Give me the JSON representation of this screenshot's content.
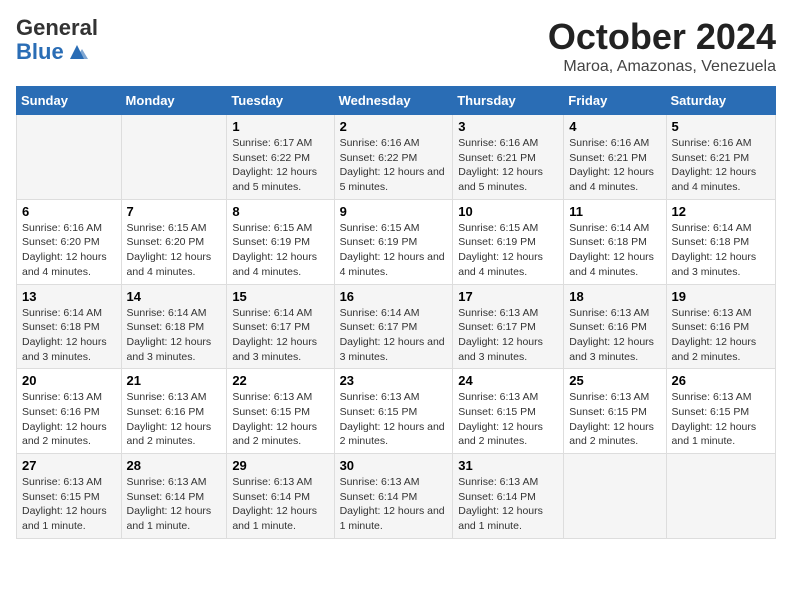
{
  "logo": {
    "general": "General",
    "blue": "Blue"
  },
  "title": "October 2024",
  "subtitle": "Maroa, Amazonas, Venezuela",
  "days_of_week": [
    "Sunday",
    "Monday",
    "Tuesday",
    "Wednesday",
    "Thursday",
    "Friday",
    "Saturday"
  ],
  "weeks": [
    [
      {
        "day": "",
        "detail": ""
      },
      {
        "day": "",
        "detail": ""
      },
      {
        "day": "1",
        "detail": "Sunrise: 6:17 AM\nSunset: 6:22 PM\nDaylight: 12 hours and 5 minutes."
      },
      {
        "day": "2",
        "detail": "Sunrise: 6:16 AM\nSunset: 6:22 PM\nDaylight: 12 hours and 5 minutes."
      },
      {
        "day": "3",
        "detail": "Sunrise: 6:16 AM\nSunset: 6:21 PM\nDaylight: 12 hours and 5 minutes."
      },
      {
        "day": "4",
        "detail": "Sunrise: 6:16 AM\nSunset: 6:21 PM\nDaylight: 12 hours and 4 minutes."
      },
      {
        "day": "5",
        "detail": "Sunrise: 6:16 AM\nSunset: 6:21 PM\nDaylight: 12 hours and 4 minutes."
      }
    ],
    [
      {
        "day": "6",
        "detail": "Sunrise: 6:16 AM\nSunset: 6:20 PM\nDaylight: 12 hours and 4 minutes."
      },
      {
        "day": "7",
        "detail": "Sunrise: 6:15 AM\nSunset: 6:20 PM\nDaylight: 12 hours and 4 minutes."
      },
      {
        "day": "8",
        "detail": "Sunrise: 6:15 AM\nSunset: 6:19 PM\nDaylight: 12 hours and 4 minutes."
      },
      {
        "day": "9",
        "detail": "Sunrise: 6:15 AM\nSunset: 6:19 PM\nDaylight: 12 hours and 4 minutes."
      },
      {
        "day": "10",
        "detail": "Sunrise: 6:15 AM\nSunset: 6:19 PM\nDaylight: 12 hours and 4 minutes."
      },
      {
        "day": "11",
        "detail": "Sunrise: 6:14 AM\nSunset: 6:18 PM\nDaylight: 12 hours and 4 minutes."
      },
      {
        "day": "12",
        "detail": "Sunrise: 6:14 AM\nSunset: 6:18 PM\nDaylight: 12 hours and 3 minutes."
      }
    ],
    [
      {
        "day": "13",
        "detail": "Sunrise: 6:14 AM\nSunset: 6:18 PM\nDaylight: 12 hours and 3 minutes."
      },
      {
        "day": "14",
        "detail": "Sunrise: 6:14 AM\nSunset: 6:18 PM\nDaylight: 12 hours and 3 minutes."
      },
      {
        "day": "15",
        "detail": "Sunrise: 6:14 AM\nSunset: 6:17 PM\nDaylight: 12 hours and 3 minutes."
      },
      {
        "day": "16",
        "detail": "Sunrise: 6:14 AM\nSunset: 6:17 PM\nDaylight: 12 hours and 3 minutes."
      },
      {
        "day": "17",
        "detail": "Sunrise: 6:13 AM\nSunset: 6:17 PM\nDaylight: 12 hours and 3 minutes."
      },
      {
        "day": "18",
        "detail": "Sunrise: 6:13 AM\nSunset: 6:16 PM\nDaylight: 12 hours and 3 minutes."
      },
      {
        "day": "19",
        "detail": "Sunrise: 6:13 AM\nSunset: 6:16 PM\nDaylight: 12 hours and 2 minutes."
      }
    ],
    [
      {
        "day": "20",
        "detail": "Sunrise: 6:13 AM\nSunset: 6:16 PM\nDaylight: 12 hours and 2 minutes."
      },
      {
        "day": "21",
        "detail": "Sunrise: 6:13 AM\nSunset: 6:16 PM\nDaylight: 12 hours and 2 minutes."
      },
      {
        "day": "22",
        "detail": "Sunrise: 6:13 AM\nSunset: 6:15 PM\nDaylight: 12 hours and 2 minutes."
      },
      {
        "day": "23",
        "detail": "Sunrise: 6:13 AM\nSunset: 6:15 PM\nDaylight: 12 hours and 2 minutes."
      },
      {
        "day": "24",
        "detail": "Sunrise: 6:13 AM\nSunset: 6:15 PM\nDaylight: 12 hours and 2 minutes."
      },
      {
        "day": "25",
        "detail": "Sunrise: 6:13 AM\nSunset: 6:15 PM\nDaylight: 12 hours and 2 minutes."
      },
      {
        "day": "26",
        "detail": "Sunrise: 6:13 AM\nSunset: 6:15 PM\nDaylight: 12 hours and 1 minute."
      }
    ],
    [
      {
        "day": "27",
        "detail": "Sunrise: 6:13 AM\nSunset: 6:15 PM\nDaylight: 12 hours and 1 minute."
      },
      {
        "day": "28",
        "detail": "Sunrise: 6:13 AM\nSunset: 6:14 PM\nDaylight: 12 hours and 1 minute."
      },
      {
        "day": "29",
        "detail": "Sunrise: 6:13 AM\nSunset: 6:14 PM\nDaylight: 12 hours and 1 minute."
      },
      {
        "day": "30",
        "detail": "Sunrise: 6:13 AM\nSunset: 6:14 PM\nDaylight: 12 hours and 1 minute."
      },
      {
        "day": "31",
        "detail": "Sunrise: 6:13 AM\nSunset: 6:14 PM\nDaylight: 12 hours and 1 minute."
      },
      {
        "day": "",
        "detail": ""
      },
      {
        "day": "",
        "detail": ""
      }
    ]
  ],
  "colors": {
    "header_bg": "#2a6db5",
    "header_text": "#ffffff",
    "odd_row": "#f5f5f5",
    "even_row": "#ffffff"
  }
}
